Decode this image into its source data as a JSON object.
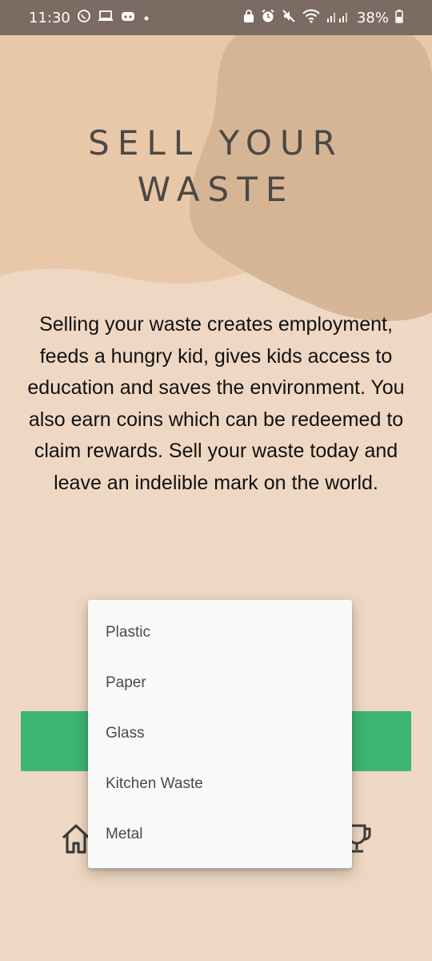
{
  "status_bar": {
    "time": "11:30",
    "battery": "38%",
    "left_icons": [
      "whatsapp-icon",
      "laptop-icon",
      "discord-icon",
      "dot-icon"
    ],
    "right_icons": [
      "lock-icon",
      "alarm-icon",
      "mute-icon",
      "wifi-icon",
      "signal-icon",
      "battery-icon"
    ]
  },
  "page": {
    "title_line1": "SELL YOUR",
    "title_line2": "WASTE",
    "description": "Selling your waste creates employment, feeds a hungry kid, gives kids access to education and saves the environment. You also earn coins which can be redeemed to claim rewards. Sell your waste today and leave an indelible mark on the world."
  },
  "dropdown": {
    "options": [
      "Plastic",
      "Paper",
      "Glass",
      "Kitchen Waste",
      "Metal"
    ]
  },
  "bottom_nav": {
    "icons": [
      "home-icon",
      "trophy-icon"
    ]
  },
  "colors": {
    "background": "#efd8c3",
    "button": "#3db673",
    "status_bar": "#7a6c62"
  }
}
